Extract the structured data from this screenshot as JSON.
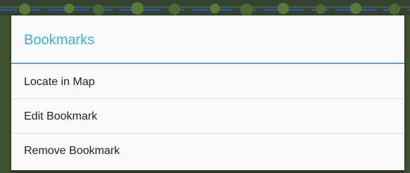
{
  "dialog": {
    "title": "Bookmarks",
    "items": [
      {
        "label": "Locate in Map"
      },
      {
        "label": "Edit Bookmark"
      },
      {
        "label": "Remove Bookmark"
      }
    ]
  },
  "colors": {
    "accent": "#33b5e5",
    "dialog_background": "#fafafa",
    "text": "#222222",
    "divider": "#dddddd"
  }
}
